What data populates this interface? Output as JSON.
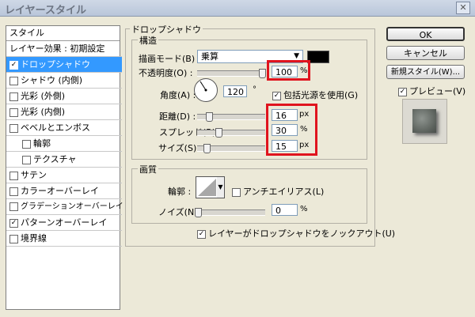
{
  "window": {
    "title": "レイヤースタイル"
  },
  "sidebar": {
    "header": "スタイル",
    "blend_defaults": "レイヤー効果 : 初期設定",
    "items": [
      {
        "label": "ドロップシャドウ",
        "checked": "✓"
      },
      {
        "label": "シャドウ (内側)",
        "checked": ""
      },
      {
        "label": "光彩 (外側)",
        "checked": ""
      },
      {
        "label": "光彩 (内側)",
        "checked": ""
      },
      {
        "label": "ベベルとエンボス",
        "checked": ""
      },
      {
        "label": "輪郭",
        "checked": ""
      },
      {
        "label": "テクスチャ",
        "checked": ""
      },
      {
        "label": "サテン",
        "checked": ""
      },
      {
        "label": "カラーオーバーレイ",
        "checked": ""
      },
      {
        "label": "グラデーションオーバーレイ",
        "checked": ""
      },
      {
        "label": "パターンオーバーレイ",
        "checked": "✓"
      },
      {
        "label": "境界線",
        "checked": ""
      }
    ]
  },
  "drop_shadow": {
    "section_title": "ドロップシャドウ",
    "structure_title": "構造",
    "blend_mode_label": "描画モード(B) :",
    "blend_mode_value": "乗算",
    "opacity_label": "不透明度(O) :",
    "opacity_value": "100",
    "opacity_pct": 1.0,
    "angle_label": "角度(A) :",
    "angle_value": "120",
    "angle_unit": "°",
    "global_light_label": "包括光源を使用(G)",
    "global_light_checked": "✓",
    "distance_label": "距離(D) :",
    "distance_value": "16",
    "spread_label": "スプレッド(R) :",
    "spread_value": "30",
    "size_label": "サイズ(S) :",
    "size_value": "15",
    "unit_px": "px",
    "unit_pct": "%",
    "quality_title": "画質",
    "contour_label": "輪郭 :",
    "antialias_label": "アンチエイリアス(L)",
    "noise_label": "ノイズ(N) :",
    "noise_value": "0",
    "knockout_label": "レイヤーがドロップシャドウをノックアウト(U)",
    "knockout_checked": "✓"
  },
  "buttons": {
    "ok": "OK",
    "cancel": "キャンセル",
    "new_style": "新規スタイル(W)...",
    "preview_label": "プレビュー(V)",
    "preview_checked": "✓"
  },
  "colors": {
    "shadow_color": "#000000",
    "highlight": "#e0141e",
    "selection": "#3399ff"
  }
}
